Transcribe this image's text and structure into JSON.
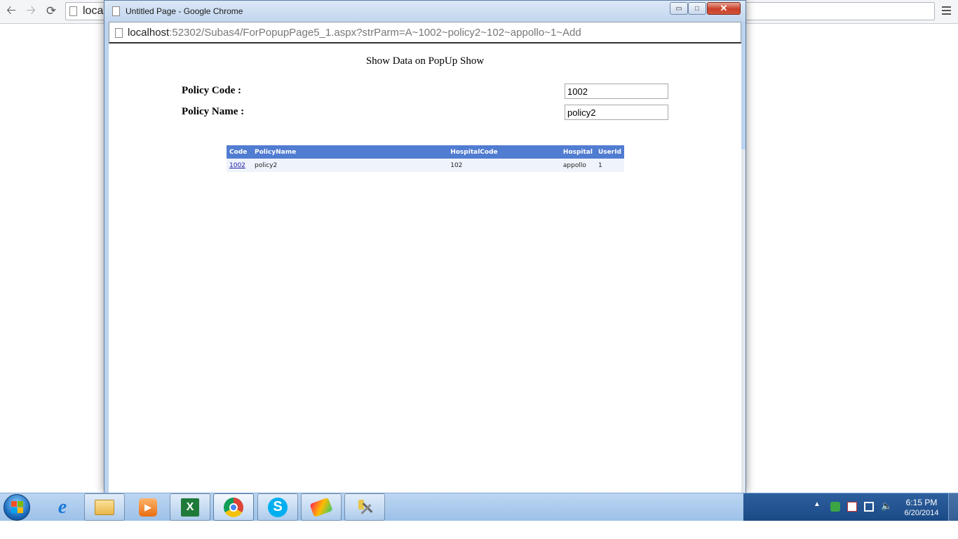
{
  "main_window": {
    "url_partial": "loca"
  },
  "popup": {
    "title": "Untitled Page - Google Chrome",
    "url_host": "localhost",
    "url_rest": ":52302/Subas4/ForPopupPage5_1.aspx?strParm=A~1002~policy2~102~appollo~1~Add",
    "window_buttons": {
      "minimize": "▭",
      "maximize": "□",
      "close": "✕"
    }
  },
  "page": {
    "heading": "Show Data on PopUp Show",
    "fields": {
      "policy_code_label": "Policy Code :",
      "policy_code_value": "1002",
      "policy_name_label": "Policy Name :",
      "policy_name_value": "policy2"
    },
    "grid": {
      "headers": [
        "Code",
        "PolicyName",
        "HospitalCode",
        "Hospital",
        "UserId"
      ],
      "rows": [
        [
          "1002",
          "policy2",
          "102",
          "appollo",
          "1"
        ]
      ]
    }
  },
  "taskbar": {
    "pinned": [
      "ie-icon",
      "explorer-icon",
      "media-player-icon",
      "excel-icon",
      "chrome-icon",
      "skype-icon",
      "paint-icon",
      "tools-icon"
    ],
    "excel_glyph": "X",
    "skype_glyph": "S",
    "ie_glyph": "e",
    "clock_time": "6:15 PM",
    "clock_date": "6/20/2014"
  }
}
